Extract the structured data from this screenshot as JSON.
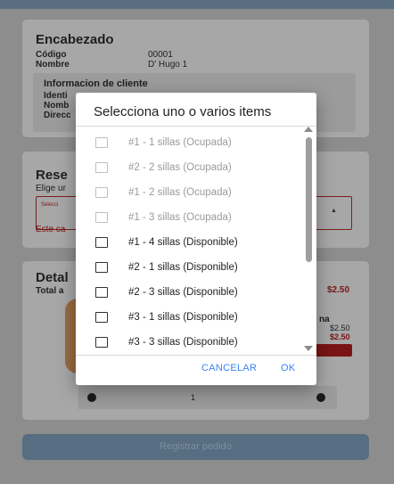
{
  "header_card": {
    "title": "Encabezado",
    "codigo_label": "Código",
    "codigo_value": "00001",
    "nombre_label": "Nombre",
    "nombre_value": "D' Hugo 1",
    "client_info_title": "Informacion de cliente",
    "identi_label": "Identi",
    "nomb_label": "Nomb",
    "direcc_label": "Direcc"
  },
  "reserve_card": {
    "title": "Rese",
    "subtitle": "Elige ur",
    "select_placeholder": "Selecci",
    "error_text": "Este ca"
  },
  "detail_card": {
    "title": "Detal",
    "total_label": "Total a",
    "total_value": "$2.50",
    "item_name_fragment": "na",
    "item_price": "$2.50",
    "item_price_bold": "$2.50",
    "quantity": "1"
  },
  "submit_label": "Registrar pedido",
  "dialog": {
    "title": "Selecciona uno o varios items",
    "items": [
      {
        "label": "#1 - 1 sillas (Ocupada)",
        "enabled": false,
        "checked": false
      },
      {
        "label": "#2 - 2 sillas (Ocupada)",
        "enabled": false,
        "checked": false
      },
      {
        "label": "#1 - 2 sillas (Ocupada)",
        "enabled": false,
        "checked": false
      },
      {
        "label": "#1 - 3 sillas (Ocupada)",
        "enabled": false,
        "checked": false
      },
      {
        "label": "#1 - 4 sillas (Disponible)",
        "enabled": true,
        "checked": false
      },
      {
        "label": "#2 - 1 sillas (Disponible)",
        "enabled": true,
        "checked": false
      },
      {
        "label": "#2 - 3 sillas (Disponible)",
        "enabled": true,
        "checked": false
      },
      {
        "label": "#3 - 1 sillas (Disponible)",
        "enabled": true,
        "checked": false
      },
      {
        "label": "#3 - 3 sillas (Disponible)",
        "enabled": true,
        "checked": false
      }
    ],
    "cancel_label": "CANCELAR",
    "ok_label": "OK"
  },
  "colors": {
    "overlay": "#8d8d8d",
    "accent": "#3b82f6",
    "error": "#7a1414"
  }
}
